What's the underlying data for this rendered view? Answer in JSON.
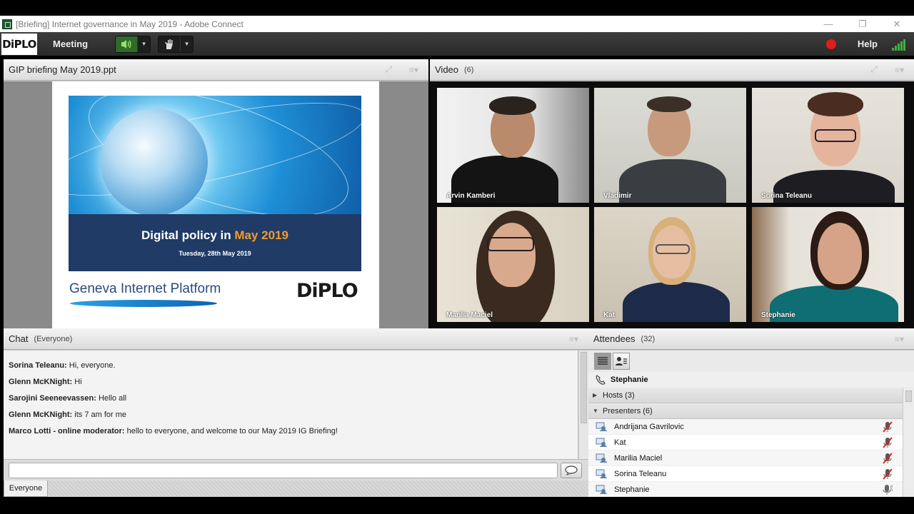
{
  "window": {
    "title": "[Briefing] Internet governance in May 2019 - Adobe Connect",
    "minimize": "—",
    "restore": "❐",
    "close": "✕"
  },
  "menubar": {
    "logo": "DiPLO",
    "meeting_label": "Meeting",
    "help_label": "Help",
    "record_color": "#e31b1b",
    "signal_color": "#3fb040"
  },
  "share_pod": {
    "title": "GIP briefing May 2019.ppt",
    "slide": {
      "title_prefix": "Digital policy in ",
      "title_highlight": "May 2019",
      "date": "Tuesday, 28th May 2019",
      "org_name": "Geneva Internet Platform",
      "org_logo": "DiPLO"
    }
  },
  "video_pod": {
    "title": "Video",
    "count": "(6)",
    "tiles": [
      {
        "name": "Arvin Kamberi"
      },
      {
        "name": "Vladimir"
      },
      {
        "name": "Sorina Teleanu"
      },
      {
        "name": "Marilia Maciel"
      },
      {
        "name": "Kat"
      },
      {
        "name": "Stephanie"
      }
    ]
  },
  "chat_pod": {
    "title": "Chat",
    "scope": "(Everyone)",
    "messages": [
      {
        "sender": "Sorina Teleanu:",
        "text": " Hi, everyone."
      },
      {
        "sender": "Glenn McKNight:",
        "text": " Hi"
      },
      {
        "sender": "Sarojini Seeneevassen:",
        "text": " Hello all"
      },
      {
        "sender": "Glenn McKNight:",
        "text": " its 7 am for me"
      },
      {
        "sender": "Marco Lotti - online moderator:",
        "text": " hello to everyone, and welcome to our May 2019 IG Briefing!"
      }
    ],
    "input_placeholder": "",
    "tab_label": "Everyone"
  },
  "attendees_pod": {
    "title": "Attendees",
    "count": "(32)",
    "me": "Stephanie",
    "groups": [
      {
        "label": "Hosts (3)",
        "expanded": false
      },
      {
        "label": "Presenters (6)",
        "expanded": true
      }
    ],
    "presenters": [
      {
        "name": "Andrijana Gavrilovic",
        "mic": "muted"
      },
      {
        "name": "Kat",
        "mic": "muted"
      },
      {
        "name": "Marilia Maciel",
        "mic": "muted"
      },
      {
        "name": "Sorina Teleanu",
        "mic": "muted"
      },
      {
        "name": "Stephanie",
        "mic": "speaking"
      }
    ]
  }
}
